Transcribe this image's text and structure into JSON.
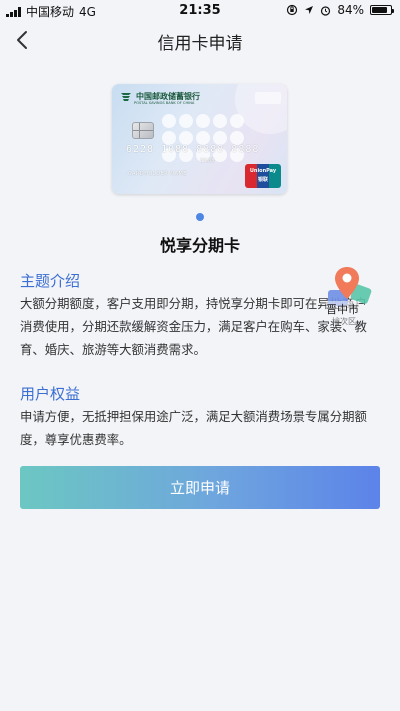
{
  "status_bar": {
    "carrier": "中国移动",
    "network": "4G",
    "time": "21:35",
    "battery_percent": "84%",
    "battery_level": 0.84
  },
  "nav": {
    "title": "信用卡申请",
    "back_icon": "chevron-left-icon"
  },
  "card": {
    "bank_name": "中国邮政储蓄银行",
    "bank_name_en": "POSTAL SAVINGS BANK OF CHINA",
    "number": "6228 1088 8888 8888",
    "expiry": "88/88",
    "holder": "CARDHOLDER NAME",
    "network_brand": "UnionPay",
    "network_brand_cn": "银联",
    "name": "悦享分期卡"
  },
  "sections": [
    {
      "title": "主题介绍",
      "body": "大额分期额度，客户支用即分期，持悦享分期卡即可在异地商户消费使用，分期还款缓解资金压力，满足客户在购车、家装、教育、婚庆、旅游等大额消费需求。"
    },
    {
      "title": "用户权益",
      "body": "申请方便，无抵押担保用途广泛，满足大额消费场景专属分期额度，尊享优惠费率。"
    }
  ],
  "overlay": {
    "location_label": "晋中市",
    "location_sub": "榆次区"
  },
  "apply_button": {
    "label": "立即申请"
  },
  "colors": {
    "accent": "#3b6ed2",
    "pager_dot": "#4e86e4",
    "button_start": "#6cc7c2",
    "button_end": "#5c83e9",
    "map_pin": "#f07a5a"
  }
}
